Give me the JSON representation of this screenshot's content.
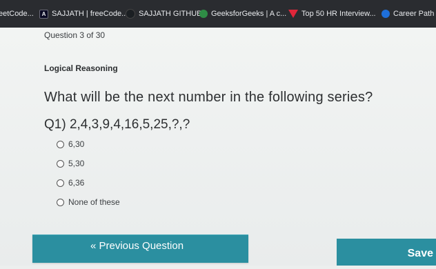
{
  "bookmarks": [
    {
      "label": "eetCode..."
    },
    {
      "label": "SAJJATH | freeCode...",
      "icon": "freecodecamp-icon"
    },
    {
      "label": "SAJJATH GITHUB",
      "icon": "github-icon"
    },
    {
      "label": "GeeksforGeeks | A c...",
      "icon": "geeksforgeeks-icon"
    },
    {
      "label": "Top 50 HR Interview...",
      "icon": "red-triangle-icon"
    },
    {
      "label": "Career Path |",
      "icon": "career-path-icon"
    }
  ],
  "quiz": {
    "progress": "Question 3 of 30",
    "category": "Logical Reasoning",
    "question": "What will be the next number in the following series?",
    "series": "Q1) 2,4,3,9,4,16,5,25,?,?",
    "options": [
      "6,30",
      "5,30",
      "6,36",
      "None of these"
    ]
  },
  "buttons": {
    "previous": "« Previous Question",
    "save": "Save"
  },
  "colors": {
    "bookmark_bar": "#2a2c30",
    "button": "#2b8fa0",
    "background": "#ecefee"
  }
}
